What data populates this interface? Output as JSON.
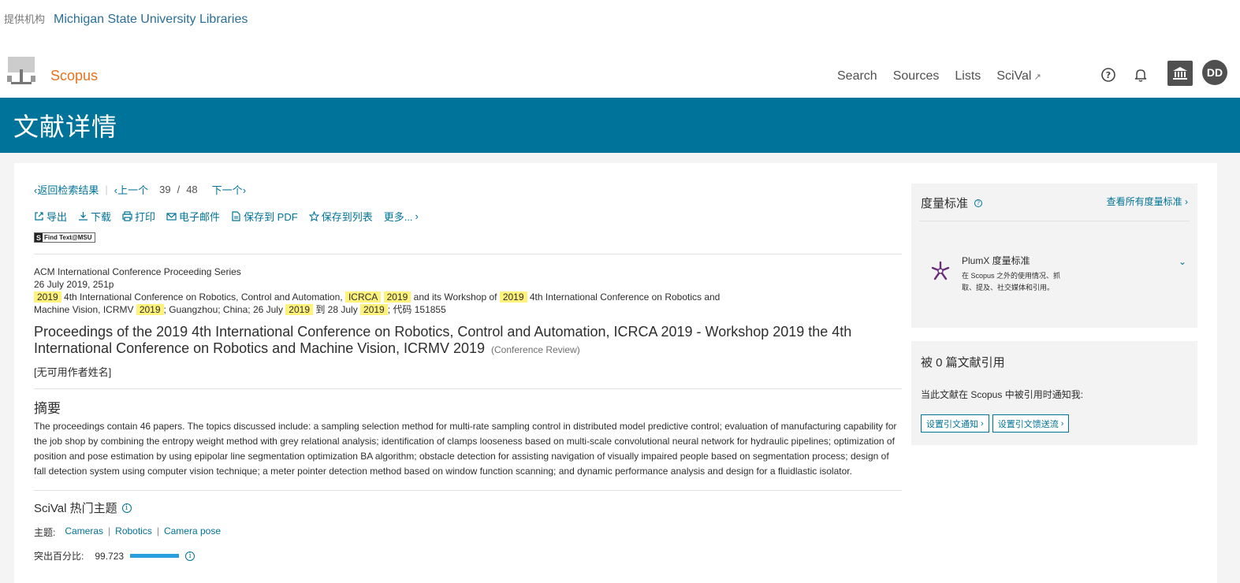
{
  "provider": {
    "label": "提供机构",
    "institution": "Michigan State University Libraries"
  },
  "header": {
    "brand": "Scopus",
    "nav": [
      "Search",
      "Sources",
      "Lists",
      "SciVal"
    ],
    "avatar_initials": "DD"
  },
  "banner": {
    "title": "文献详情"
  },
  "pager": {
    "back": "返回检索结果",
    "prev": "上一个",
    "current": "39",
    "slash": "/",
    "total": "48",
    "next": "下一个"
  },
  "actions": [
    "导出",
    "下载",
    "打印",
    "电子邮件",
    "保存到 PDF",
    "保存到列表",
    "更多..."
  ],
  "findtext": "Find Text@MSU",
  "source": {
    "series": "ACM International Conference Proceeding Series",
    "date_pages": "26 July 2019, 251p",
    "line3": [
      {
        "t": "2019",
        "hl": true
      },
      {
        "t": " 4th International Conference on Robotics, Control and Automation, ",
        "hl": false
      },
      {
        "t": "ICRCA",
        "hl": true
      },
      {
        "t": " ",
        "hl": false
      },
      {
        "t": "2019",
        "hl": true
      },
      {
        "t": " and its Workshop of ",
        "hl": false
      },
      {
        "t": "2019",
        "hl": true
      },
      {
        "t": " 4th International Conference on Robotics and",
        "hl": false
      }
    ],
    "line4": [
      {
        "t": "Machine Vision, ICRMV ",
        "hl": false
      },
      {
        "t": "2019",
        "hl": true
      },
      {
        "t": "; Guangzhou; China; 26 July ",
        "hl": false
      },
      {
        "t": "2019",
        "hl": true
      },
      {
        "t": " 到 28 July ",
        "hl": false
      },
      {
        "t": "2019",
        "hl": true
      },
      {
        "t": "; 代码 151855",
        "hl": false
      }
    ]
  },
  "document": {
    "title_line1": "Proceedings of the 2019 4th International Conference on Robotics, Control and Automation, ICRCA 2019 - Workshop 2019 the 4th",
    "title_line2": "International Conference on Robotics and Machine Vision, ICRMV 2019",
    "doc_type": "(Conference Review)",
    "authors": "[无可用作者姓名]"
  },
  "abstract": {
    "heading": "摘要",
    "text": "The proceedings contain 46 papers. The topics discussed include: a sampling selection method for multi-rate sampling control in distributed model predictive control; evaluation of manufacturing capability for the job shop by combining the entropy weight method with grey relational analysis; identification of clamps looseness based on multi-scale convolutional neural network for hydraulic pipelines; optimization of position and pose estimation by using epipolar line segmentation optimization BA algorithm; obstacle detection for assisting navigation of visually impaired people based on segmentation process; design of fall detection system using computer vision technique; a meter pointer detection method based on window function scanning; and dynamic performance analysis and design for a fluidlastic isolator."
  },
  "scival": {
    "heading": "SciVal 热门主题",
    "topics_label": "主题:",
    "topics": [
      "Cameras",
      "Robotics",
      "Camera pose"
    ],
    "prominence_label": "突出百分比:",
    "prominence_value": "99.723",
    "prominence_fraction": 0.997
  },
  "metrics": {
    "heading": "度量标准",
    "view_all": "查看所有度量标准",
    "plumx_title": "PlumX 度量标准",
    "plumx_desc": "在 Scopus 之外的使用情况、抓取、提及、社交媒体和引用。"
  },
  "citations": {
    "heading": "被 0 篇文献引用",
    "notify": "当此文献在 Scopus 中被引用时通知我:",
    "btn_alert": "设置引文通知",
    "btn_feed": "设置引文馈送流"
  },
  "colors": {
    "banner": "#00739a",
    "link": "#007398",
    "brand": "#e9711c",
    "highlight": "#fff27a"
  }
}
